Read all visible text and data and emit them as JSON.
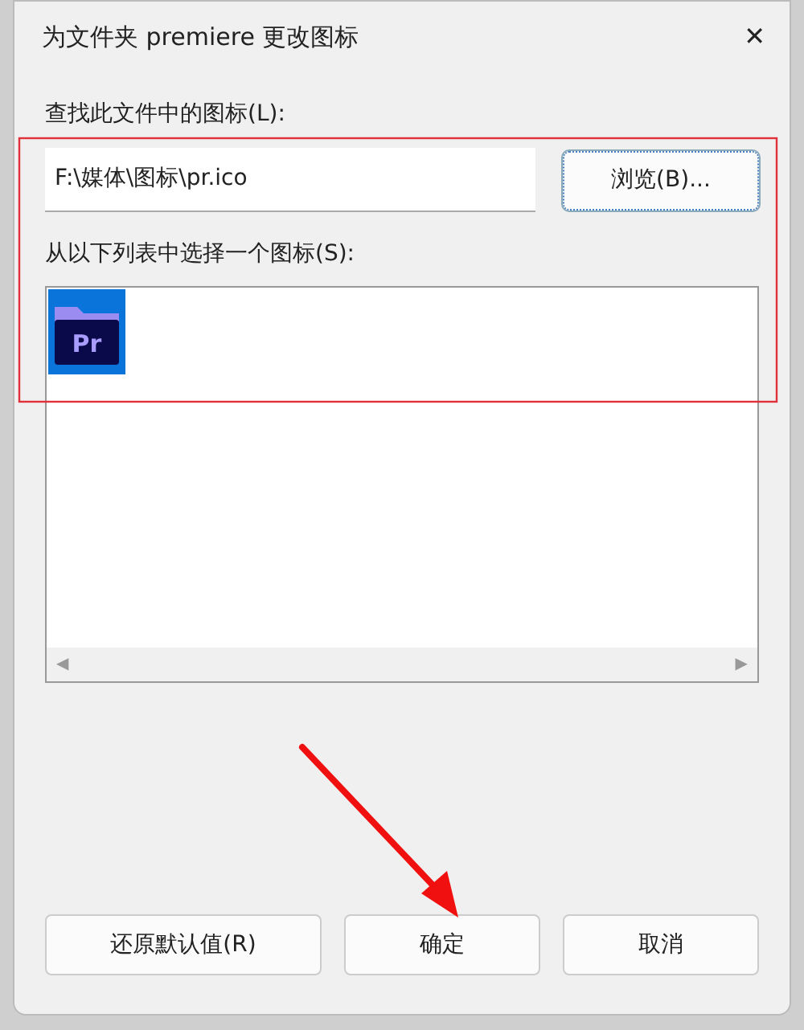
{
  "window": {
    "title": "为文件夹 premiere 更改图标",
    "close": "✕"
  },
  "file_label": "查找此文件中的图标(L):",
  "file_field": {
    "value": "F:\\媒体\\图标\\pr.ico"
  },
  "browse_button": "浏览(B)...",
  "list_label": "从以下列表中选择一个图标(S):",
  "icons": [
    {
      "text": "Pr",
      "selected": true
    }
  ],
  "scrollbar": {
    "left": "◀",
    "right": "▶"
  },
  "buttons": [
    {
      "label": "还原默认值(R)"
    },
    {
      "label": "确定"
    },
    {
      "label": "取消"
    }
  ]
}
